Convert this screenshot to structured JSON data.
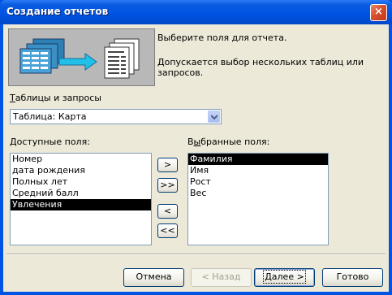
{
  "window": {
    "title": "Создание отчетов",
    "close_label": "×"
  },
  "description": {
    "line1": "Выберите поля для отчета.",
    "line2": "Допускается выбор нескольких таблиц или запросов."
  },
  "tables": {
    "label": "Таблицы и запросы",
    "selected": "Таблица: Карта"
  },
  "available": {
    "label": "Доступные поля:",
    "items": [
      "Номер",
      "дата рождения",
      "Полных лет",
      "Средний балл",
      "Увлечения"
    ],
    "selected_index": 4
  },
  "selected_fields": {
    "label": "Выбранные поля:",
    "items": [
      "Фамилия",
      "Имя",
      "Рост",
      "Вес"
    ],
    "selected_index": 0
  },
  "move_buttons": {
    "add_one": ">",
    "add_all": ">>",
    "remove_one": "<",
    "remove_all": "<<"
  },
  "footer": {
    "cancel": "Отмена",
    "back": "< Назад",
    "next": "Далее >",
    "finish": "Готово"
  }
}
